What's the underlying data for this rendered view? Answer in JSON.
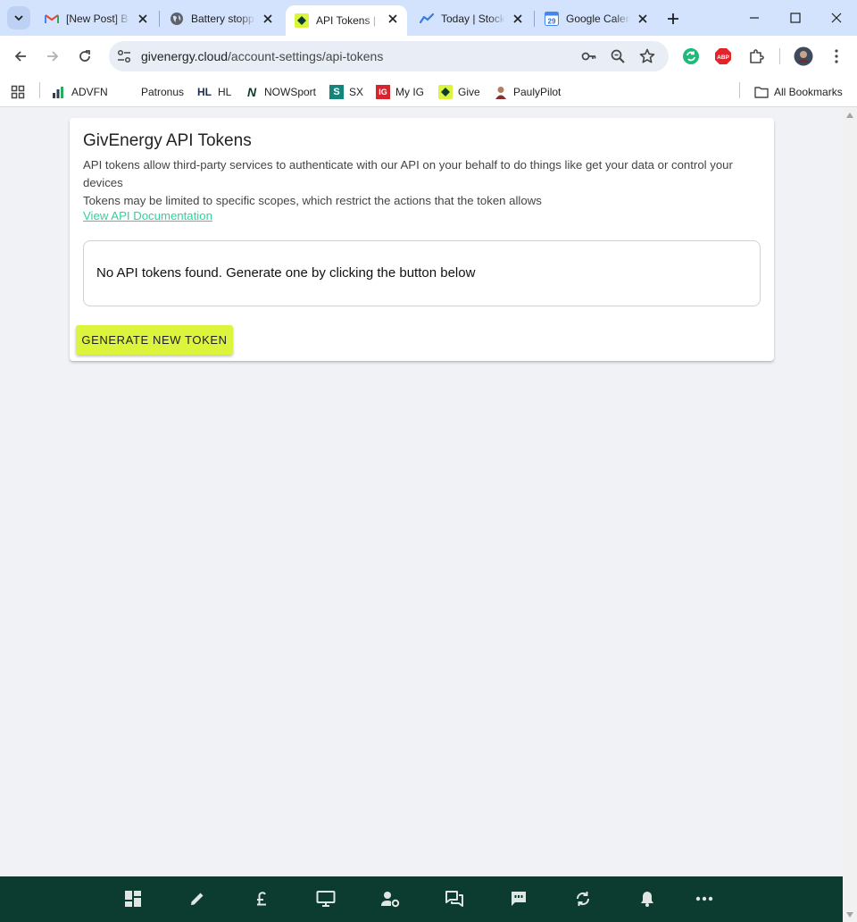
{
  "browser": {
    "tabs": [
      {
        "title": "[New Post] B",
        "icon": "gmail-icon",
        "active": false
      },
      {
        "title": "Battery stopp",
        "icon": "globe-icon",
        "active": false
      },
      {
        "title": "API Tokens | G",
        "icon": "givenergy-icon",
        "active": true
      },
      {
        "title": "Today | Stock",
        "icon": "chart-line-icon",
        "active": false
      },
      {
        "title": "Google Calen",
        "icon": "google-calendar-icon",
        "active": false
      }
    ],
    "calendar_day": "29",
    "url_domain": "givenergy.cloud",
    "url_path": "/account-settings/api-tokens",
    "extensions": {
      "abp_label": "ABP"
    },
    "bookmarks": [
      {
        "label": "ADVFN",
        "icon": "advfn-icon"
      },
      {
        "label": "Patronus",
        "icon": ""
      },
      {
        "label": "HL",
        "icon": "hl-icon",
        "icon_text": "HL"
      },
      {
        "label": "NOWSport",
        "icon": "nowsport-icon",
        "icon_text": "N"
      },
      {
        "label": "SX",
        "icon": "sx-icon",
        "icon_text": "S"
      },
      {
        "label": "My IG",
        "icon": "ig-icon",
        "icon_text": "IG"
      },
      {
        "label": "Give",
        "icon": "givenergy-icon"
      },
      {
        "label": "PaulyPilot",
        "icon": "avatar-icon"
      }
    ],
    "all_bookmarks_label": "All Bookmarks"
  },
  "page": {
    "title": "GivEnergy API Tokens",
    "description_1": "API tokens allow third-party services to authenticate with our API on your behalf to do things like get your data or control your devices",
    "description_2": "Tokens may be limited to specific scopes, which restrict the actions that the token allows",
    "doc_link": "View API Documentation",
    "empty_message": "No API tokens found. Generate one by clicking the button below",
    "generate_button": "GENERATE NEW TOKEN"
  },
  "bottom_nav": [
    "dashboard-icon",
    "edit-icon",
    "pound-icon",
    "monitor-icon",
    "account-settings-icon",
    "forum-icon",
    "feedback-icon",
    "sync-icon",
    "bell-icon",
    "more-icon"
  ],
  "colors": {
    "accent": "#dcf43c",
    "link": "#2fd39a",
    "bottom_nav_bg": "#0c3b30",
    "tabstrip_bg": "#d3e3fd"
  }
}
